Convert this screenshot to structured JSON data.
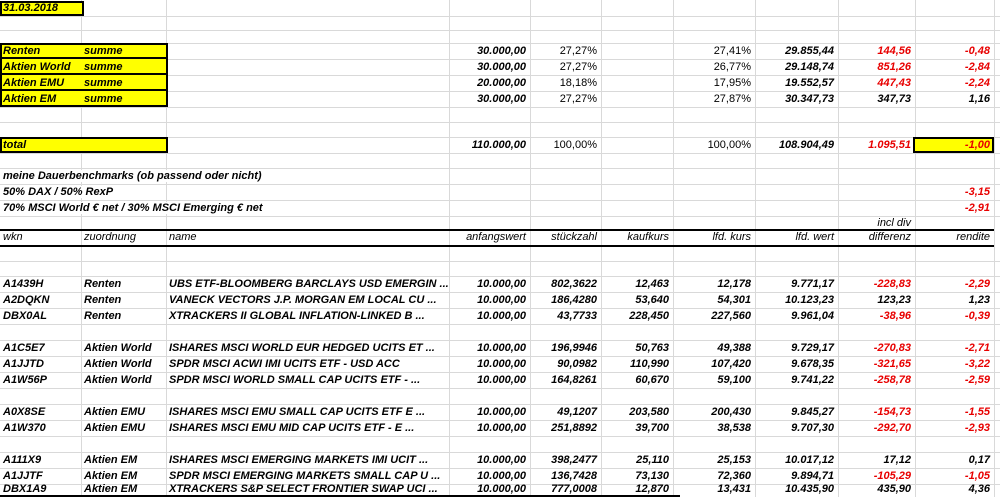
{
  "date_label": "31.03.2018",
  "summary_rows": [
    {
      "label": "Renten",
      "sub": "summe",
      "wert": "30.000,00",
      "soll": "27,27%",
      "ist": "27,41%",
      "lfdwert": "29.855,44",
      "diff": "144,56",
      "rend": "-0,48"
    },
    {
      "label": "Aktien World",
      "sub": "summe",
      "wert": "30.000,00",
      "soll": "27,27%",
      "ist": "26,77%",
      "lfdwert": "29.148,74",
      "diff": "851,26",
      "rend": "-2,84"
    },
    {
      "label": "Aktien EMU",
      "sub": "summe",
      "wert": "20.000,00",
      "soll": "18,18%",
      "ist": "17,95%",
      "lfdwert": "19.552,57",
      "diff": "447,43",
      "rend": "-2,24"
    },
    {
      "label": "Aktien EM",
      "sub": "summe",
      "wert": "30.000,00",
      "soll": "27,27%",
      "ist": "27,87%",
      "lfdwert": "30.347,73",
      "diff": "347,73",
      "rend": "1,16"
    }
  ],
  "total_row": {
    "label": "total",
    "wert": "110.000,00",
    "soll": "100,00%",
    "ist": "100,00%",
    "lfdwert": "108.904,49",
    "diff": "1.095,51",
    "rend": "-1,00"
  },
  "benchmarks": {
    "title": "meine Dauerbenchmarks (ob passend oder nicht)",
    "rows": [
      {
        "label": "50% DAX / 50% RexP",
        "rend": "-3,15"
      },
      {
        "label": "70% MSCI World € net / 30% MSCI Emerging € net",
        "rend": "-2,91"
      }
    ]
  },
  "incl_div_label": "incl div",
  "headers": {
    "wkn": "wkn",
    "zuordnung": "zuordnung",
    "name": "name",
    "anfangswert": "anfangswert",
    "stueckzahl": "stückzahl",
    "kaufkurs": "kaufkurs",
    "lfd_kurs": "lfd. kurs",
    "lfd_wert": "lfd. wert",
    "differenz": "differenz",
    "rendite": "rendite"
  },
  "positions": [
    {
      "wkn": "A1439H",
      "zuordnung": "Renten",
      "name": "UBS ETF-BLOOMBERG BARCLAYS USD EMERGIN ...",
      "anfangswert": "10.000,00",
      "stueckzahl": "802,3622",
      "kaufkurs": "12,463",
      "lfd_kurs": "12,178",
      "lfd_wert": "9.771,17",
      "differenz": "-228,83",
      "rendite": "-2,29"
    },
    {
      "wkn": "A2DQKN",
      "zuordnung": "Renten",
      "name": "VANECK VECTORS J.P. MORGAN EM LOCAL CU ...",
      "anfangswert": "10.000,00",
      "stueckzahl": "186,4280",
      "kaufkurs": "53,640",
      "lfd_kurs": "54,301",
      "lfd_wert": "10.123,23",
      "differenz": "123,23",
      "rendite": "1,23"
    },
    {
      "wkn": "DBX0AL",
      "zuordnung": "Renten",
      "name": "XTRACKERS II GLOBAL INFLATION-LINKED B ...",
      "anfangswert": "10.000,00",
      "stueckzahl": "43,7733",
      "kaufkurs": "228,450",
      "lfd_kurs": "227,560",
      "lfd_wert": "9.961,04",
      "differenz": "-38,96",
      "rendite": "-0,39"
    },
    {
      "wkn": "A1C5E7",
      "zuordnung": "Aktien World",
      "name": "ISHARES MSCI WORLD EUR HEDGED UCITS ET ...",
      "anfangswert": "10.000,00",
      "stueckzahl": "196,9946",
      "kaufkurs": "50,763",
      "lfd_kurs": "49,388",
      "lfd_wert": "9.729,17",
      "differenz": "-270,83",
      "rendite": "-2,71"
    },
    {
      "wkn": "A1JJTD",
      "zuordnung": "Aktien World",
      "name": "SPDR MSCI ACWI IMI UCITS ETF - USD ACC",
      "anfangswert": "10.000,00",
      "stueckzahl": "90,0982",
      "kaufkurs": "110,990",
      "lfd_kurs": "107,420",
      "lfd_wert": "9.678,35",
      "differenz": "-321,65",
      "rendite": "-3,22"
    },
    {
      "wkn": "A1W56P",
      "zuordnung": "Aktien World",
      "name": "SPDR MSCI WORLD SMALL CAP UCITS ETF - ...",
      "anfangswert": "10.000,00",
      "stueckzahl": "164,8261",
      "kaufkurs": "60,670",
      "lfd_kurs": "59,100",
      "lfd_wert": "9.741,22",
      "differenz": "-258,78",
      "rendite": "-2,59"
    },
    {
      "wkn": "A0X8SE",
      "zuordnung": "Aktien EMU",
      "name": "ISHARES MSCI EMU SMALL CAP UCITS ETF E ...",
      "anfangswert": "10.000,00",
      "stueckzahl": "49,1207",
      "kaufkurs": "203,580",
      "lfd_kurs": "200,430",
      "lfd_wert": "9.845,27",
      "differenz": "-154,73",
      "rendite": "-1,55"
    },
    {
      "wkn": "A1W370",
      "zuordnung": "Aktien EMU",
      "name": "ISHARES MSCI EMU MID CAP UCITS ETF - E ...",
      "anfangswert": "10.000,00",
      "stueckzahl": "251,8892",
      "kaufkurs": "39,700",
      "lfd_kurs": "38,538",
      "lfd_wert": "9.707,30",
      "differenz": "-292,70",
      "rendite": "-2,93"
    },
    {
      "wkn": "A111X9",
      "zuordnung": "Aktien EM",
      "name": "ISHARES MSCI EMERGING MARKETS IMI UCIT ...",
      "anfangswert": "10.000,00",
      "stueckzahl": "398,2477",
      "kaufkurs": "25,110",
      "lfd_kurs": "25,153",
      "lfd_wert": "10.017,12",
      "differenz": "17,12",
      "rendite": "0,17"
    },
    {
      "wkn": "A1JJTF",
      "zuordnung": "Aktien EM",
      "name": "SPDR MSCI EMERGING MARKETS SMALL CAP U ...",
      "anfangswert": "10.000,00",
      "stueckzahl": "136,7428",
      "kaufkurs": "73,130",
      "lfd_kurs": "72,360",
      "lfd_wert": "9.894,71",
      "differenz": "-105,29",
      "rendite": "-1,05"
    },
    {
      "wkn": "DBX1A9",
      "zuordnung": "Aktien EM",
      "name": "XTRACKERS S&P SELECT FRONTIER SWAP UCI ...",
      "anfangswert": "10.000,00",
      "stueckzahl": "777,0008",
      "kaufkurs": "12,870",
      "lfd_kurs": "13,431",
      "lfd_wert": "10.435,90",
      "differenz": "435,90",
      "rendite": "4,36"
    }
  ],
  "colors": {
    "highlight": "#ffff00",
    "negative_text": "#e80000",
    "gridline": "#d9d9d9",
    "border": "#000000"
  }
}
